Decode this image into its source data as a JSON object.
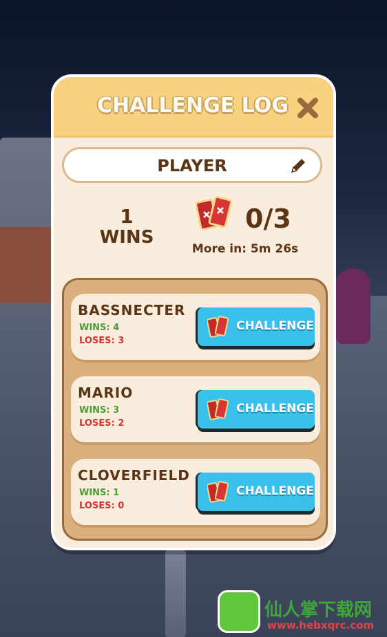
{
  "header": {
    "title": "CHALLENGE LOG"
  },
  "player": {
    "name": "PLAYER"
  },
  "stats": {
    "wins_count": "1",
    "wins_label": "WINS",
    "tickets": "0/3",
    "refill": "More in: 5m 26s"
  },
  "opponents": [
    {
      "name": "BASSNECTER",
      "wins": "WINS: 4",
      "loses": "LOSES: 3",
      "button": "CHALLENGE"
    },
    {
      "name": "MARIO",
      "wins": "WINS: 3",
      "loses": "LOSES: 2",
      "button": "CHALLENGE"
    },
    {
      "name": "CLOVERFIELD",
      "wins": "WINS: 1",
      "loses": "LOSES: 0",
      "button": "CHALLENGE"
    }
  ],
  "watermark": {
    "text": "仙人掌下载网",
    "url": "www.hebxqrc.com"
  },
  "colors": {
    "header": "#f8d27e",
    "panel": "#fbeddd",
    "button": "#39c1ec",
    "wins": "#4a9a35",
    "loses": "#d13431"
  },
  "icons": {
    "close": "close-icon",
    "edit": "pencil-icon",
    "tickets": "ticket-icon"
  }
}
